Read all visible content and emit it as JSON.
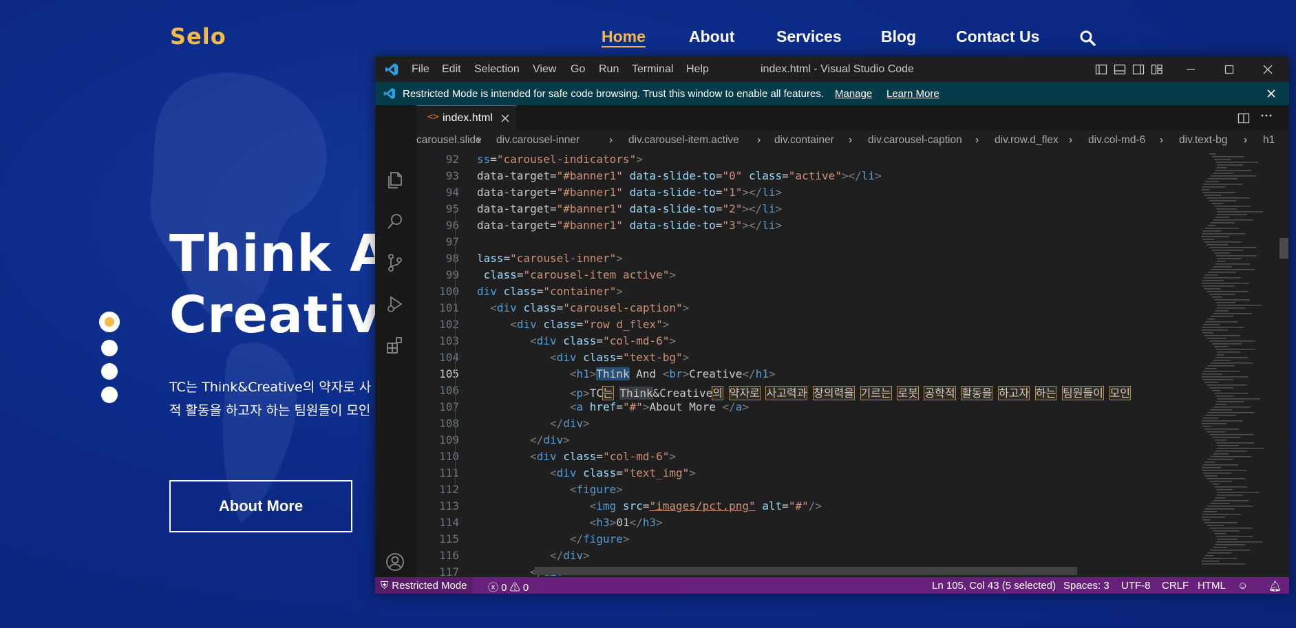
{
  "site": {
    "logo": "Selo",
    "nav": [
      "Home",
      "About",
      "Services",
      "Blog",
      "Contact Us"
    ],
    "hero_line1": "Think An",
    "hero_line2": "Creative",
    "hero_p1": "TC는 Think&Creative의 약자로 사",
    "hero_p2": "적 활동을 하고자 하는 팀원들이 모인",
    "button": "About More",
    "accent": "#f5b94a",
    "background": "#0c2a88"
  },
  "vscode": {
    "menu": [
      "File",
      "Edit",
      "Selection",
      "View",
      "Go",
      "Run",
      "Terminal",
      "Help"
    ],
    "window_title": "index.html - Visual Studio Code",
    "banner_text": "Restricted Mode is intended for safe code browsing. Trust this window to enable all features.",
    "banner_manage": "Manage",
    "banner_learn": "Learn More",
    "tab_label": "index.html",
    "breadcrumb": [
      "carousel.slide",
      "div.carousel-inner",
      "div.carousel-item.active",
      "div.container",
      "div.carousel-caption",
      "div.row.d_flex",
      "div.col-md-6",
      "div.text-bg",
      "h1"
    ],
    "line_numbers": [
      "92",
      "93",
      "94",
      "95",
      "96",
      "97",
      "98",
      "99",
      "100",
      "101",
      "102",
      "103",
      "104",
      "105",
      "106",
      "107",
      "108",
      "109",
      "110",
      "111",
      "112",
      "113",
      "114",
      "115",
      "116",
      "117"
    ],
    "current_line": "105",
    "status": {
      "mode": "Restricted Mode",
      "errors": "0",
      "warnings": "0",
      "position": "Ln 105, Col 43 (5 selected)",
      "spaces": "Spaces: 3",
      "encoding": "UTF-8",
      "eol": "CRLF",
      "language": "HTML"
    }
  }
}
